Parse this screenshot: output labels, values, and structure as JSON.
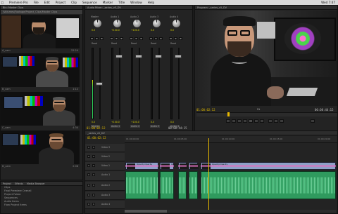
{
  "menubar": {
    "apple_icon": "apple-icon",
    "items": [
      "Premiere Pro",
      "File",
      "Edit",
      "Project",
      "Clip",
      "Sequence",
      "Marker",
      "Title",
      "Window",
      "Help"
    ],
    "clock": "Wed 7:47"
  },
  "window_title": "/Users/editor/Documents/Adobe/Premiere Pro/6.0/Premiere Overall Edit.prproj",
  "bins": {
    "tab": "Bin: Master Clips",
    "path": "/Volumes/Footage/Project_Clips/Master Clips",
    "clips": [
      {
        "name": "A_cam",
        "duration": "12:24"
      },
      {
        "name": "B_cam",
        "duration": "1:12"
      },
      {
        "name": "C_cam",
        "duration": "4:34"
      },
      {
        "name": "D_cam",
        "duration": "2:08"
      }
    ]
  },
  "mixer": {
    "tab": "Audio Mixer: _series_v5_DV",
    "channels": [
      {
        "name": "Master",
        "value": "0.0",
        "label": "Master"
      },
      {
        "name": "Audio 1",
        "value": "+100.0",
        "label": "Audio 1"
      },
      {
        "name": "Audio 2",
        "value": "+100.0",
        "label": "Audio 2"
      },
      {
        "name": "Audio 3",
        "value": "0.0",
        "label": "Audio 3"
      },
      {
        "name": "Audio 4",
        "value": "0.0",
        "label": "Audio 4"
      }
    ],
    "read_label": "Read",
    "timecode_left": "01:00:02:12",
    "timecode_right": "00:08:44:15",
    "master_level": 0.55
  },
  "program": {
    "tab": "Program: _series_v5_DV",
    "timecode_left": "01:00:02:12",
    "fit_label": "Fit",
    "timecode_right": "00:08:44:15",
    "playhead_fraction": 0.22
  },
  "timeline": {
    "tab": "_series_v5_DV",
    "timecode": "01:00:02:12",
    "ruler_labels": [
      "01:00:00:00",
      "01:00:05:00",
      "01:00:10:00",
      "01:00:15:00",
      "01:00:20:00"
    ],
    "tracks": [
      {
        "name": "Video 3"
      },
      {
        "name": "Video 2"
      },
      {
        "name": "Video 1"
      },
      {
        "name": "Audio 1"
      },
      {
        "name": "Audio 2"
      },
      {
        "name": "Audio 3"
      },
      {
        "name": "Audio 4"
      }
    ],
    "video_clip_label": "Opacity:Opacity",
    "playhead_fraction": 0.39,
    "accent": "#e070c0",
    "audio_color": "#2f9a5e",
    "video_color": "#8ea0c8"
  },
  "project": {
    "tabs": [
      "Project",
      "Effects",
      "Media Browser"
    ],
    "items": [
      "Clips",
      "Final Premiere Overall",
      "Project Folder",
      "Sequences",
      "Audio Items",
      "Flow Project Items"
    ]
  }
}
